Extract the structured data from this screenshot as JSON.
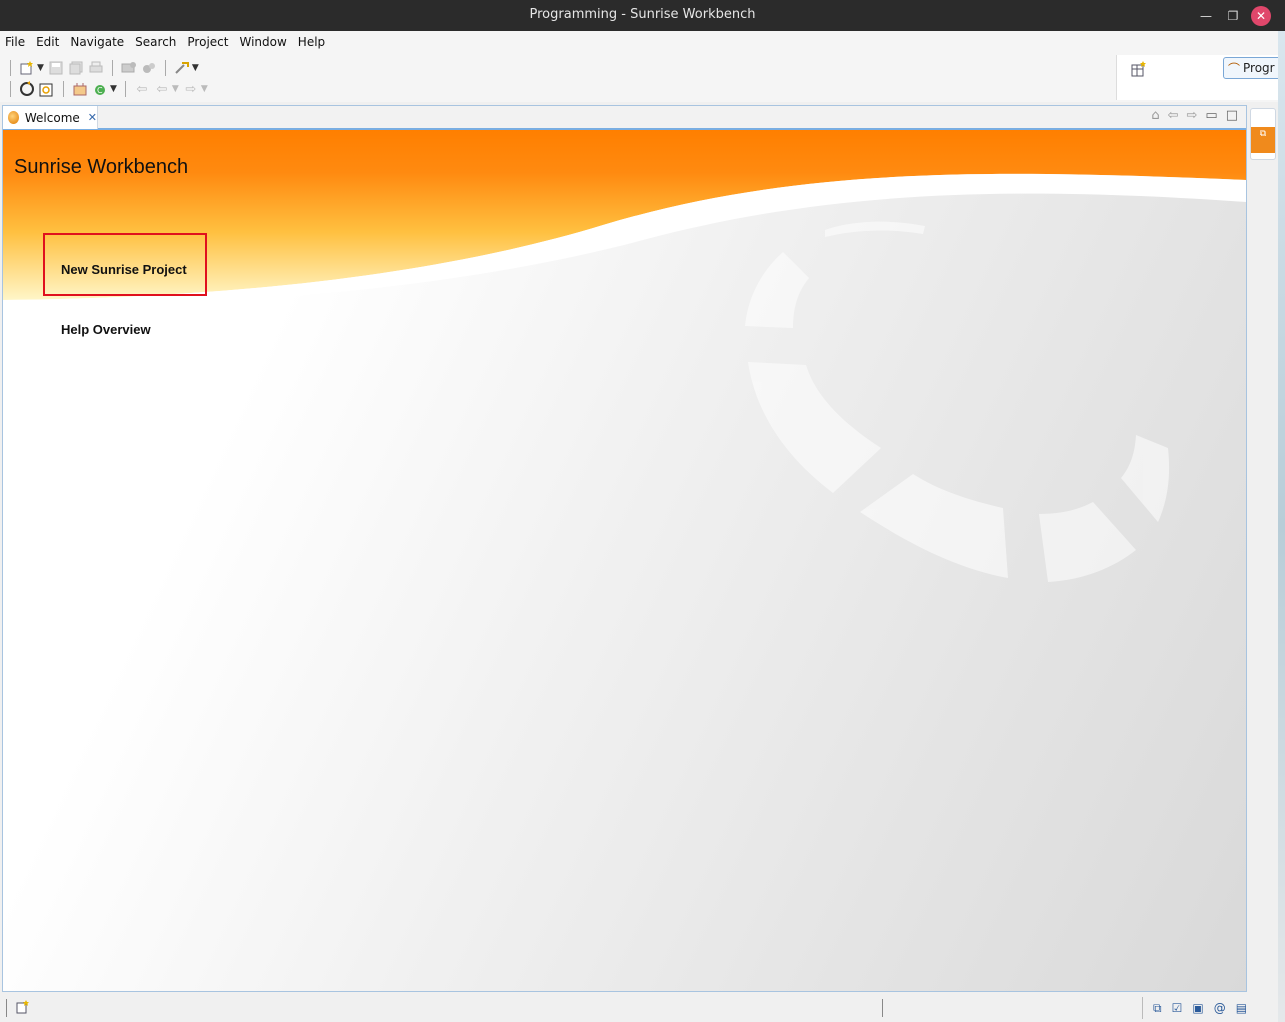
{
  "window": {
    "title": "Programming - Sunrise Workbench",
    "minimize": "—",
    "maximize": "❐",
    "close": "✕"
  },
  "menu": [
    {
      "label": "File"
    },
    {
      "label": "Edit"
    },
    {
      "label": "Navigate"
    },
    {
      "label": "Search"
    },
    {
      "label": "Project"
    },
    {
      "label": "Window"
    },
    {
      "label": "Help"
    }
  ],
  "perspective": {
    "label": "Progr"
  },
  "editor": {
    "tab_label": "Welcome",
    "tab_close": "✕"
  },
  "welcome": {
    "title": "Sunrise Workbench",
    "links": {
      "new_project": "New Sunrise Project",
      "help_overview": "Help Overview"
    }
  },
  "colors": {
    "accent_orange": "#ff7f00",
    "highlight_red": "#e0101e",
    "tab_border": "#7aaee2"
  }
}
